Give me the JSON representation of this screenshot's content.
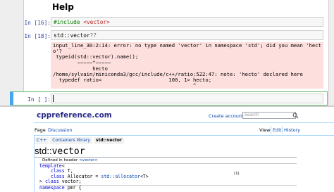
{
  "notebook": {
    "heading": "Help",
    "cells": [
      {
        "prompt": "In [16]:",
        "code_directive": "#include",
        "code_rest": " <vector>"
      },
      {
        "prompt": "In [18]:",
        "code_ns": "std::vector",
        "code_suffix": "??"
      }
    ],
    "error_lines": [
      "input_line_30:2:14: error: no type named 'vector' in namespace 'std'; did you mean 'hect",
      "o'?",
      " typeid(std::vector).name();",
      "        ~~~~~^~~~~~",
      "             hecto",
      "/home/sylvain/miniconda3/gcc/include/c++/ratio:522:47: note: 'hecto' declared here",
      "  typedef ratio<                      100, 1> hecto;",
      "                                              ^"
    ],
    "active_prompt": "In [ ]:"
  },
  "cppref": {
    "logo": "cppreference.com",
    "create_account": "Create account",
    "search_placeholder": "Search",
    "tabs": {
      "page": "Page",
      "discussion": "Discussion",
      "view": "View",
      "edit": "Edit",
      "history": "History"
    },
    "breadcrumbs": [
      "C++",
      "Containers library",
      "std::vector"
    ],
    "title_ns": "std::",
    "title_name": "vector",
    "defined_in_prefix": "Defined in header ",
    "defined_in_header": "<vector>",
    "decl_lines": [
      {
        "parts": [
          [
            "k",
            "template"
          ],
          [
            "",
            "<"
          ]
        ]
      },
      {
        "parts": [
          [
            "",
            "    "
          ],
          [
            "k",
            "class"
          ],
          [
            "",
            " T,"
          ]
        ]
      },
      {
        "parts": [
          [
            "",
            "    "
          ],
          [
            "k",
            "class"
          ],
          [
            "",
            " Allocator = "
          ],
          [
            "t",
            "std::allocator"
          ],
          [
            "",
            "<T>"
          ]
        ]
      },
      {
        "parts": [
          [
            "",
            "> "
          ],
          [
            "k",
            "class"
          ],
          [
            "",
            " vector;"
          ]
        ]
      }
    ],
    "decl_number": "(1)",
    "namespace_line": [
      [
        "k",
        "namespace"
      ],
      [
        "",
        " pmr {"
      ]
    ]
  }
}
